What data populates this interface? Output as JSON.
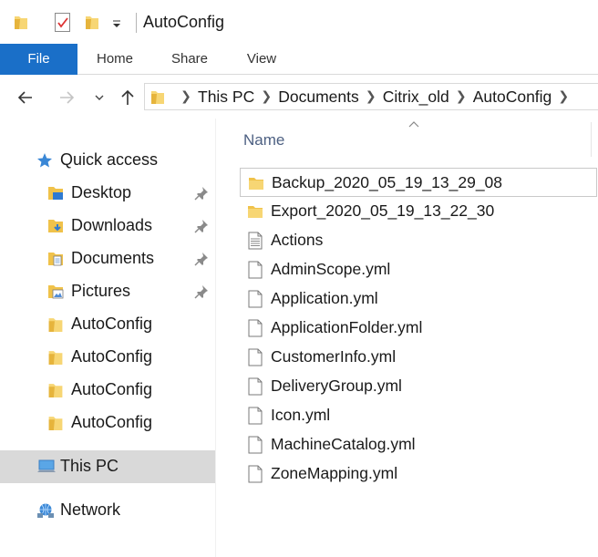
{
  "window": {
    "title": "AutoConfig"
  },
  "ribbon": {
    "tabs": [
      {
        "label": "File"
      },
      {
        "label": "Home"
      },
      {
        "label": "Share"
      },
      {
        "label": "View"
      }
    ]
  },
  "address_bar": {
    "crumbs": [
      "This PC",
      "Documents",
      "Citrix_old",
      "AutoConfig"
    ]
  },
  "nav_pane": {
    "quick_access": "Quick access",
    "pinned": [
      {
        "label": "Desktop",
        "icon": "desktop-folder-icon"
      },
      {
        "label": "Downloads",
        "icon": "downloads-folder-icon"
      },
      {
        "label": "Documents",
        "icon": "documents-folder-icon"
      },
      {
        "label": "Pictures",
        "icon": "pictures-folder-icon"
      }
    ],
    "recent": [
      {
        "label": "AutoConfig"
      },
      {
        "label": "AutoConfig"
      },
      {
        "label": "AutoConfig"
      },
      {
        "label": "AutoConfig"
      }
    ],
    "this_pc": "This PC",
    "network": "Network"
  },
  "file_list": {
    "column_name": "Name",
    "items": [
      {
        "name": "Backup_2020_05_19_13_29_08",
        "type": "folder"
      },
      {
        "name": "Export_2020_05_19_13_22_30",
        "type": "folder"
      },
      {
        "name": "Actions",
        "type": "text-file"
      },
      {
        "name": "AdminScope.yml",
        "type": "file"
      },
      {
        "name": "Application.yml",
        "type": "file"
      },
      {
        "name": "ApplicationFolder.yml",
        "type": "file"
      },
      {
        "name": "CustomerInfo.yml",
        "type": "file"
      },
      {
        "name": "DeliveryGroup.yml",
        "type": "file"
      },
      {
        "name": "Icon.yml",
        "type": "file"
      },
      {
        "name": "MachineCatalog.yml",
        "type": "file"
      },
      {
        "name": "ZoneMapping.yml",
        "type": "file"
      }
    ]
  },
  "colors": {
    "accent": "#1a6fc8",
    "folder": "#f0c24a",
    "selection": "#d9d9d9"
  }
}
